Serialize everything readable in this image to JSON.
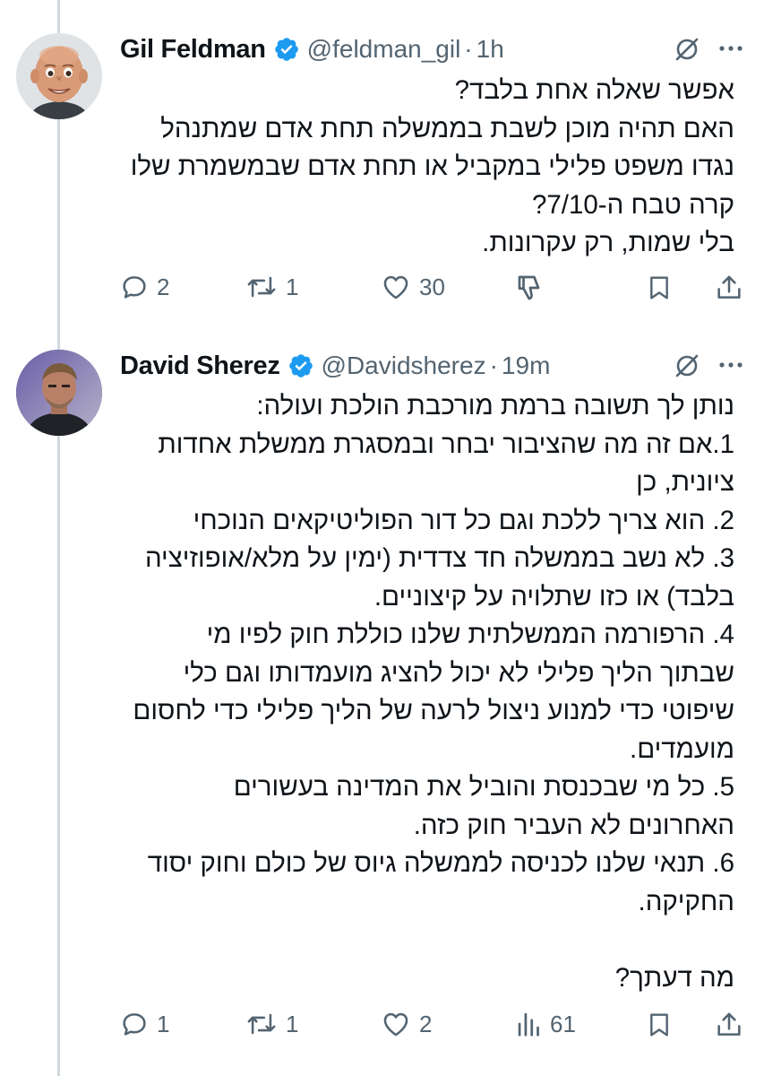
{
  "tweets": [
    {
      "author_name": "Gil Feldman",
      "handle": "@feldman_gil",
      "separator": "·",
      "time": "1h",
      "lines": [
        "אפשר שאלה אחת בלבד?",
        "האם תהיה מוכן לשבת בממשלה תחת אדם שמתנהל",
        "נגדו משפט פלילי במקביל או תחת אדם שבמשמרת שלו",
        "קרה טבח ה-7/10?",
        "בלי שמות, רק עקרונות."
      ],
      "stats": {
        "replies": "2",
        "reposts": "1",
        "likes": "30"
      }
    },
    {
      "author_name": "David Sherez",
      "handle": "@Davidsherez",
      "separator": "·",
      "time": "19m",
      "lines": [
        "נותן לך תשובה ברמת מורכבת הולכת ועולה:",
        "1.אם זה מה שהציבור יבחר ובמסגרת ממשלת אחדות",
        "ציונית, כן",
        "2. הוא צריך ללכת וגם כל דור הפוליטיקאים הנוכחי",
        "3. לא נשב בממשלה חד צדדית (ימין על מלא/אופוזיציה",
        "בלבד) או כזו שתלויה על קיצוניים.",
        "4.  הרפורמה הממשלתית שלנו כוללת חוק לפיו מי",
        "שבתוך הליך פלילי לא יכול להציג מועמדותו וגם כלי",
        "שיפוטי כדי למנוע ניצול לרעה של הליך פלילי כדי לחסום",
        "מועמדים.",
        "5. כל מי שבכנסת והוביל את המדינה בעשורים",
        "האחרונים לא העביר חוק כזה.",
        "6. תנאי שלנו לכניסה לממשלה גיוס של כולם וחוק יסוד",
        "החקיקה.",
        "",
        "מה דעתך?"
      ],
      "stats": {
        "replies": "1",
        "reposts": "1",
        "likes": "2",
        "views": "61"
      }
    }
  ],
  "colors": {
    "verified": "#1d9bf0",
    "text": "#0f1419",
    "muted": "#536471",
    "thread_line": "#cfd9de"
  },
  "icons": [
    "verified-badge-icon",
    "grok-slash-icon",
    "more-icon",
    "reply-icon",
    "repost-icon",
    "like-icon",
    "dislike-icon",
    "bookmark-icon",
    "share-icon",
    "views-icon"
  ]
}
